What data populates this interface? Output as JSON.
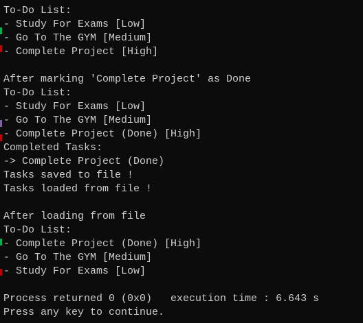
{
  "console": {
    "background": "#0c0c0c",
    "text_color": "#cccccc",
    "lines": [
      "To-Do List:",
      "- Study For Exams [Low]",
      "- Go To The GYM [Medium]",
      "- Complete Project [High]",
      "",
      "After marking 'Complete Project' as Done",
      "To-Do List:",
      "- Study For Exams [Low]",
      "- Go To The GYM [Medium]",
      "- Complete Project (Done) [High]",
      "Completed Tasks:",
      "-> Complete Project (Done)",
      "Tasks saved to file !",
      "Tasks loaded from file !",
      "",
      "After loading from file",
      "To-Do List:",
      "- Complete Project (Done) [High]",
      "- Go To The GYM [Medium]",
      "- Study For Exams [Low]",
      "",
      "Process returned 0 (0x0)   execution time : 6.643 s",
      "Press any key to continue."
    ]
  },
  "edge_markers": {
    "colors": [
      "#00b050",
      "#c00000",
      "#8064a2"
    ]
  }
}
